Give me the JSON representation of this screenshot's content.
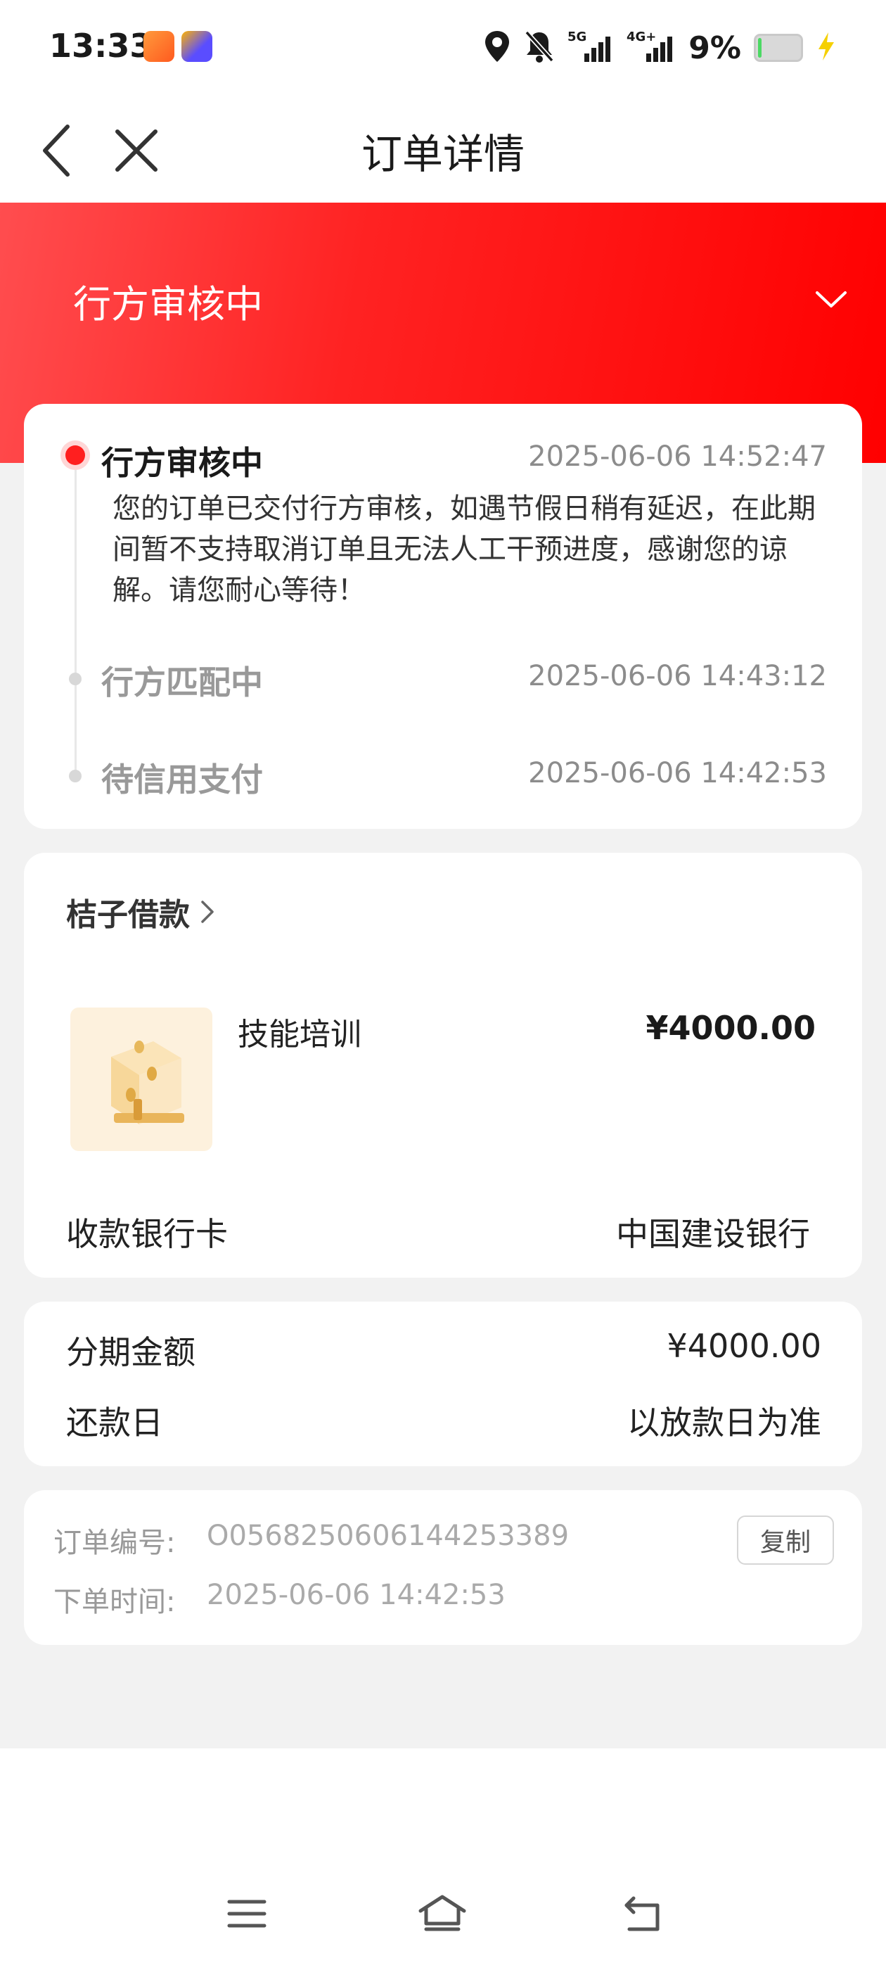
{
  "status_bar": {
    "time": "13:33",
    "network_5g": "5G",
    "network_4g": "4G+",
    "battery_percent": "9%",
    "battery_level": 0.09,
    "icons": [
      "app-icon-1",
      "app-icon-2",
      "location-icon",
      "mute-bell-icon",
      "signal-5g-icon",
      "signal-4g-icon",
      "battery-icon",
      "charging-icon"
    ]
  },
  "titlebar": {
    "title": "订单详情"
  },
  "header": {
    "status": "行方审核中"
  },
  "timeline": [
    {
      "title": "行方审核中",
      "time": "2025-06-06 14:52:47",
      "desc": "您的订单已交付行方审核，如遇节假日稍有延迟，在此期间暂不支持取消订单且无法人工干预进度，感谢您的谅解。请您耐心等待！",
      "active": true
    },
    {
      "title": "行方匹配中",
      "time": "2025-06-06 14:43:12",
      "active": false
    },
    {
      "title": "待信用支付",
      "time": "2025-06-06 14:42:53",
      "active": false
    }
  ],
  "product": {
    "merchant": "桔子借款",
    "item_name": "技能培训",
    "price": "¥4000.00",
    "bank_label": "收款银行卡",
    "bank_value": "中国建设银行"
  },
  "installment": {
    "amount_label": "分期金额",
    "amount_value": "¥4000.00",
    "repay_label": "还款日",
    "repay_value": "以放款日为准"
  },
  "order_info": {
    "order_no_label": "订单编号:",
    "order_no_value": "O0568250606144253389",
    "copy_label": "复制",
    "order_time_label": "下单时间:",
    "order_time_value": "2025-06-06 14:42:53"
  },
  "colors": {
    "accent_red": "#ff1f1f",
    "page_bg": "#f2f2f2"
  }
}
